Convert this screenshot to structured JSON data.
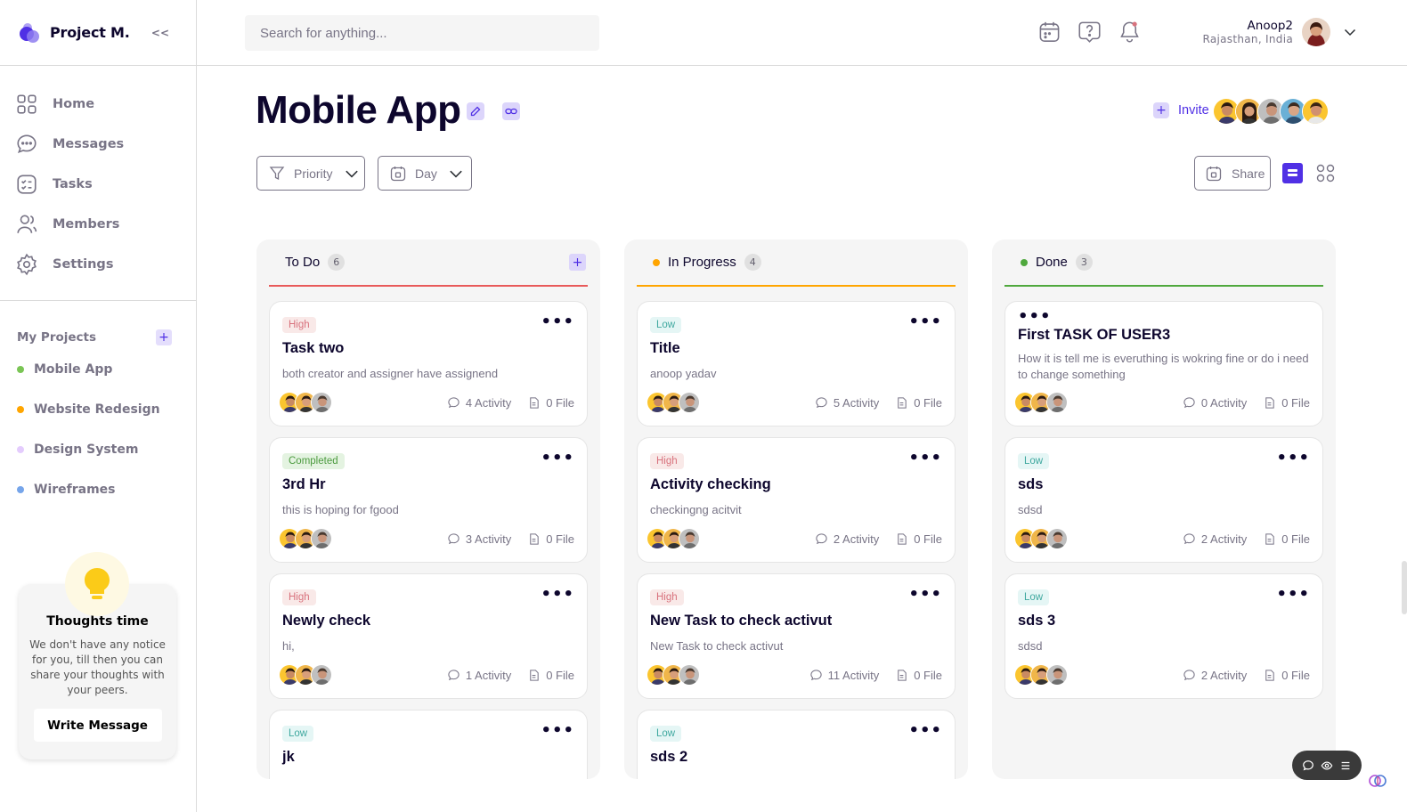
{
  "brand": {
    "name": "Project M.",
    "collapse": "<<"
  },
  "nav": [
    {
      "label": "Home",
      "icon": "home-icon"
    },
    {
      "label": "Messages",
      "icon": "messages-icon"
    },
    {
      "label": "Tasks",
      "icon": "tasks-icon"
    },
    {
      "label": "Members",
      "icon": "members-icon"
    },
    {
      "label": "Settings",
      "icon": "settings-icon"
    }
  ],
  "projects": {
    "title": "My Projects",
    "add": "+",
    "items": [
      {
        "label": "Mobile App",
        "color": "#7ac555"
      },
      {
        "label": "Website Redesign",
        "color": "#ffa500"
      },
      {
        "label": "Design System",
        "color": "#e4ccfd"
      },
      {
        "label": "Wireframes",
        "color": "#76a5ea"
      }
    ]
  },
  "thoughts": {
    "title": "Thoughts time",
    "text": "We don't have any notice for you, till then you can share your thoughts with your peers.",
    "button": "Write Message"
  },
  "search": {
    "placeholder": "Search for anything..."
  },
  "user": {
    "name": "Anoop2",
    "location": "Rajasthan, India"
  },
  "page": {
    "title": "Mobile App",
    "invite": "Invite",
    "invite_plus": "+",
    "filters": {
      "priority": "Priority",
      "day": "Day",
      "share": "Share"
    }
  },
  "colors": {
    "accent": "#5030e5",
    "todo": "#e85a5a",
    "progress": "#ffa500",
    "done": "#4fa83d"
  },
  "columns": [
    {
      "name": "To Do",
      "count": "6",
      "cards": [
        {
          "badge": "High",
          "badge_type": "high",
          "title": "Task two",
          "desc": "both creator and assigner have assignend",
          "activity": "4 Activity",
          "files": "0 File"
        },
        {
          "badge": "Completed",
          "badge_type": "done",
          "title": "3rd Hr",
          "desc": "this is hoping for fgood",
          "activity": "3 Activity",
          "files": "0 File"
        },
        {
          "badge": "High",
          "badge_type": "high",
          "title": "Newly check",
          "desc": "hi,",
          "activity": "1 Activity",
          "files": "0 File"
        },
        {
          "badge": "Low",
          "badge_type": "low",
          "title": "jk",
          "desc": "",
          "activity": "",
          "files": ""
        }
      ]
    },
    {
      "name": "In Progress",
      "count": "4",
      "cards": [
        {
          "badge": "Low",
          "badge_type": "low",
          "title": "Title",
          "desc": "anoop yadav",
          "activity": "5 Activity",
          "files": "0 File"
        },
        {
          "badge": "High",
          "badge_type": "high",
          "title": "Activity checking",
          "desc": "checkingng acitvit",
          "activity": "2 Activity",
          "files": "0 File"
        },
        {
          "badge": "High",
          "badge_type": "high",
          "title": "New Task to check activut",
          "desc": "New Task to check activut",
          "activity": "11 Activity",
          "files": "0 File"
        },
        {
          "badge": "Low",
          "badge_type": "low",
          "title": "sds 2",
          "desc": "",
          "activity": "",
          "files": ""
        }
      ]
    },
    {
      "name": "Done",
      "count": "3",
      "cards": [
        {
          "badge": "",
          "badge_type": "none",
          "title": "First TASK OF USER3",
          "desc": "How it is tell me is everuthing is wokring fine or do i need to change something",
          "activity": "0 Activity",
          "files": "0 File"
        },
        {
          "badge": "Low",
          "badge_type": "low",
          "title": "sds",
          "desc": "sdsd",
          "activity": "2 Activity",
          "files": "0 File"
        },
        {
          "badge": "Low",
          "badge_type": "low",
          "title": "sds 3",
          "desc": "sdsd",
          "activity": "2 Activity",
          "files": "0 File"
        }
      ]
    }
  ]
}
